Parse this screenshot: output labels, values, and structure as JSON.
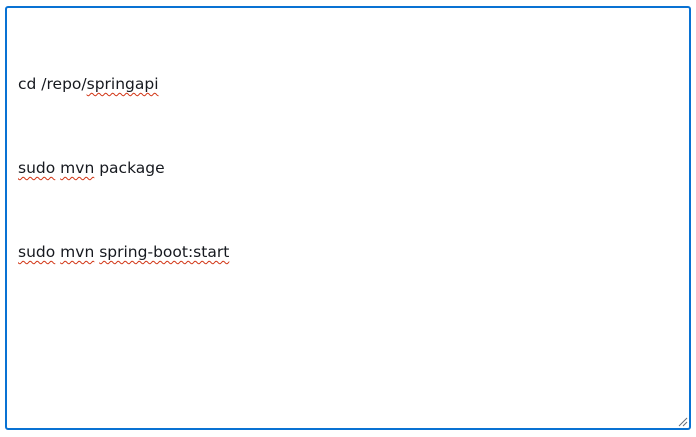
{
  "editor": {
    "lines": [
      [
        {
          "text": "cd /repo/",
          "spell_error": false
        },
        {
          "text": "springapi",
          "spell_error": true
        }
      ],
      [
        {
          "text": "sudo",
          "spell_error": true
        },
        {
          "text": " ",
          "spell_error": false
        },
        {
          "text": "mvn",
          "spell_error": true
        },
        {
          "text": " package",
          "spell_error": false
        }
      ],
      [
        {
          "text": "sudo",
          "spell_error": true
        },
        {
          "text": " ",
          "spell_error": false
        },
        {
          "text": "mvn",
          "spell_error": true
        },
        {
          "text": " ",
          "spell_error": false
        },
        {
          "text": "spring-boot:start",
          "spell_error": true
        }
      ]
    ],
    "border_color": "#0972d3",
    "spellcheck_color": "#d13212",
    "resize_icon": "resize-grip-icon"
  }
}
